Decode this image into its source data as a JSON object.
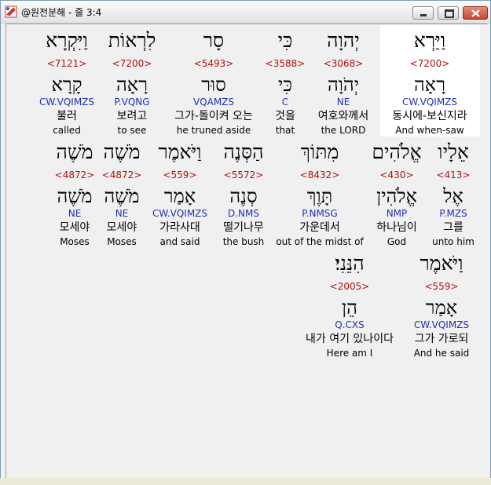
{
  "window": {
    "title": "@원전분해 - 줄 3:4"
  },
  "colors": {
    "strongs_number": "#b01010",
    "parsing": "#2030b0",
    "highlight_bg": "#ffffff"
  },
  "words": [
    {
      "hebrew": "וַיַּרְא",
      "strongs": "<7200>",
      "lemma": "רָאָה",
      "parsing": "CW.VQIMZS",
      "korean": "동시에-보신지라",
      "english": "And when-saw",
      "highlighted": true
    },
    {
      "hebrew": "יְהוָה",
      "strongs": "<3068>",
      "lemma": "יְהֹוָה",
      "parsing": "NE",
      "korean": "여호와께서",
      "english": "the LORD"
    },
    {
      "hebrew": "כִּי",
      "strongs": "<3588>",
      "lemma": "כִּי",
      "parsing": "C",
      "korean": "것을",
      "english": "that"
    },
    {
      "hebrew": "סָר",
      "strongs": "<5493>",
      "lemma": "סוּר",
      "parsing": "VQAMZS",
      "korean": "그가-돌이켜 오는",
      "english": "he truned aside"
    },
    {
      "hebrew": "לִרְאוֹת",
      "strongs": "<7200>",
      "lemma": "רָאָה",
      "parsing": "P.VQNG",
      "korean": "보려고",
      "english": "to see"
    },
    {
      "hebrew": "וַיִּקְרָא",
      "strongs": "<7121>",
      "lemma": "קָרָא",
      "parsing": "CW.VQIMZS",
      "korean": "불러",
      "english": "called"
    },
    {
      "hebrew": "אֵלָיו",
      "strongs": "<413>",
      "lemma": "אֶל",
      "parsing": "P.MZS",
      "korean": "그를",
      "english": "unto him"
    },
    {
      "hebrew": "אֱלֹהִים",
      "strongs": "<430>",
      "lemma": "אֱלֹהִין",
      "parsing": "NMP",
      "korean": "하나님이",
      "english": "God"
    },
    {
      "hebrew": "מִתּוֹךְ",
      "strongs": "<8432>",
      "lemma": "תָּוֶךְ",
      "parsing": "P.NMSG",
      "korean": "가운데서",
      "english": "out of the midst of"
    },
    {
      "hebrew": "הַסְּנֶה",
      "strongs": "<5572>",
      "lemma": "סְנֶה",
      "parsing": "D.NMS",
      "korean": "떨기나무",
      "english": "the bush"
    },
    {
      "hebrew": "וַיֹּאמֶר",
      "strongs": "<559>",
      "lemma": "אָמַר",
      "parsing": "CW.VQIMZS",
      "korean": "가라사대",
      "english": "and said"
    },
    {
      "hebrew": "מֹשֶׁה",
      "strongs": "<4872>",
      "lemma": "מֹשֶׁה",
      "parsing": "NE",
      "korean": "모세야",
      "english": "Moses"
    },
    {
      "hebrew": "מֹשֶׁה",
      "strongs": "<4872>",
      "lemma": "מֹשֶׁה",
      "parsing": "NE",
      "korean": "모세야",
      "english": "Moses"
    },
    {
      "hebrew": "וַיֹּאמֶר",
      "strongs": "<559>",
      "lemma": "אָמַר",
      "parsing": "CW.VQIMZS",
      "korean": "그가 가로되",
      "english": "And he said"
    },
    {
      "hebrew": "הִנֵּנִי׃",
      "strongs": "<2005>",
      "lemma": "הֵן",
      "parsing": "Q.CXS",
      "korean": "내가 여기 있나이다",
      "english": "Here am I"
    }
  ]
}
